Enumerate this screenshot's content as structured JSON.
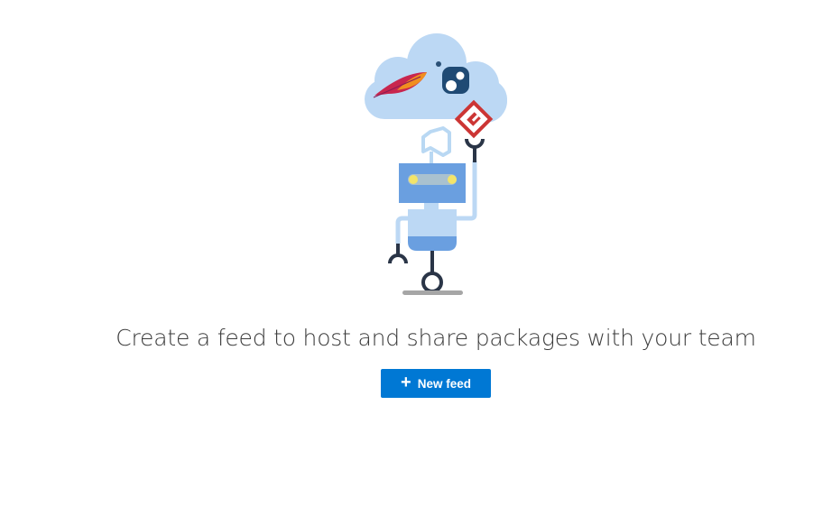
{
  "empty_state": {
    "headline": "Create a feed to host and share packages with your team",
    "button_label": "New feed",
    "button_icon": "plus-icon"
  },
  "colors": {
    "accent": "#0078d4",
    "cloud": "#b9d8f3",
    "robot_body": "#6a9fe0",
    "robot_dark": "#2a3547"
  }
}
